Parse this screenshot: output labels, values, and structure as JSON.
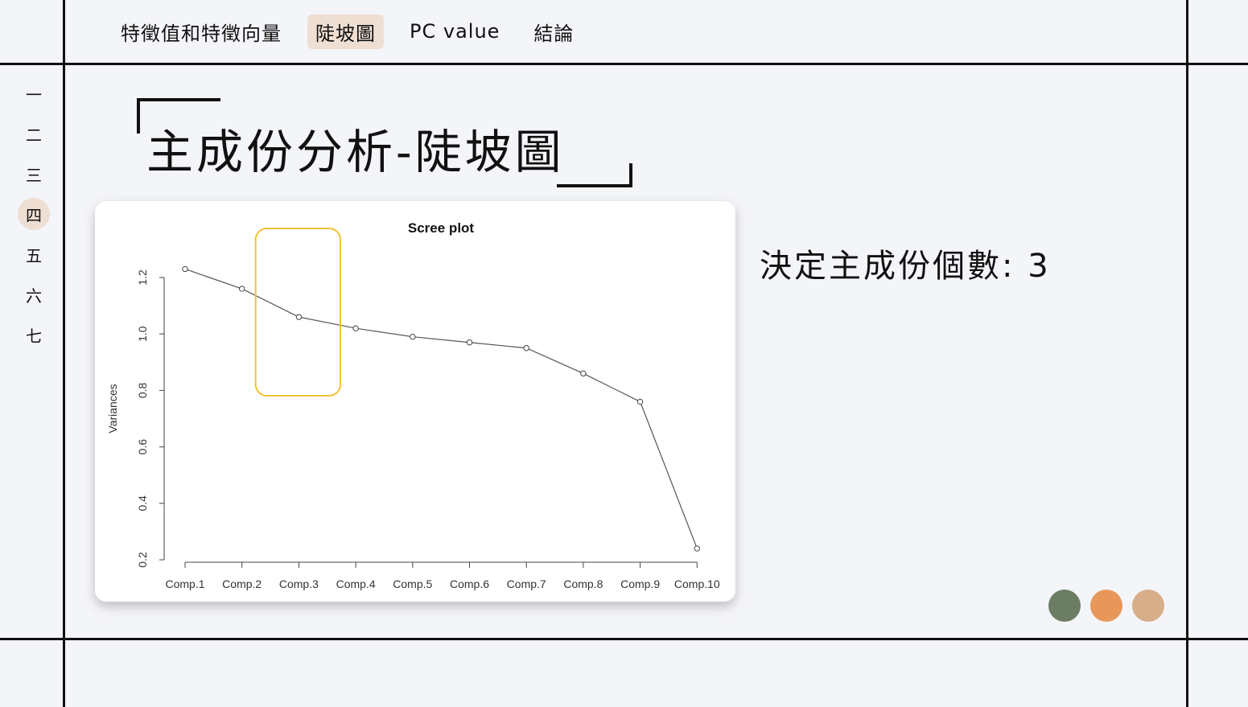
{
  "nav": {
    "tabs": [
      {
        "label": "特徵值和特徵向量",
        "active": false
      },
      {
        "label": "陡坡圖",
        "active": true
      },
      {
        "label": "PC value",
        "active": false
      },
      {
        "label": "結論",
        "active": false
      }
    ]
  },
  "side_nav": {
    "items": [
      {
        "label": "一",
        "active": false
      },
      {
        "label": "二",
        "active": false
      },
      {
        "label": "三",
        "active": false
      },
      {
        "label": "四",
        "active": true
      },
      {
        "label": "五",
        "active": false
      },
      {
        "label": "六",
        "active": false
      },
      {
        "label": "七",
        "active": false
      }
    ]
  },
  "page_title": "主成份分析-陡坡圖",
  "conclusion_text": "決定主成份個數: 3",
  "theme_colors": [
    "#6b7d63",
    "#e8975a",
    "#d7ae8a"
  ],
  "highlight_color": "#f2c233",
  "chart_data": {
    "type": "line",
    "title": "Scree plot",
    "xlabel": "",
    "ylabel": "Variances",
    "categories": [
      "Comp.1",
      "Comp.2",
      "Comp.3",
      "Comp.4",
      "Comp.5",
      "Comp.6",
      "Comp.7",
      "Comp.8",
      "Comp.9",
      "Comp.10"
    ],
    "values": [
      1.23,
      1.16,
      1.06,
      1.02,
      0.99,
      0.97,
      0.95,
      0.86,
      0.76,
      0.24
    ],
    "yticks": [
      0.2,
      0.4,
      0.6,
      0.8,
      1.0,
      1.2
    ],
    "ytick_labels": [
      "0.2",
      "0.4",
      "0.6",
      "0.8",
      "1.0",
      "1.2"
    ],
    "ylim": [
      0.2,
      1.2
    ],
    "grid": false,
    "highlight_categories": [
      "Comp.3",
      "Comp.4"
    ]
  }
}
